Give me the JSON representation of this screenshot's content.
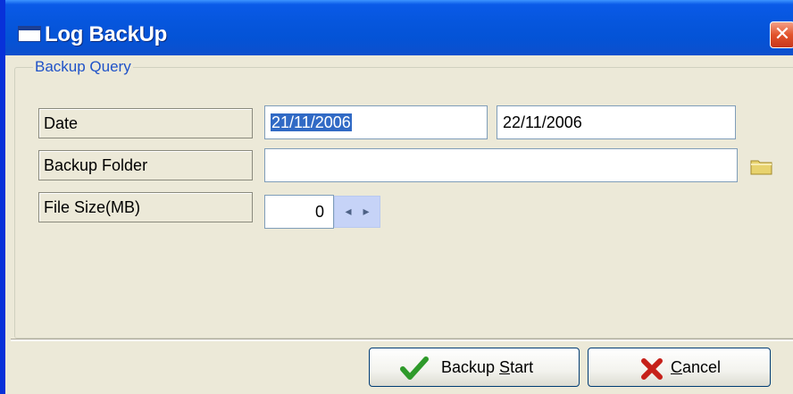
{
  "window": {
    "title": "Log BackUp",
    "close_symbol": "✕"
  },
  "group": {
    "title": "Backup Query"
  },
  "fields": {
    "date": {
      "label": "Date",
      "from": "21/11/2006",
      "to": "22/11/2006"
    },
    "backup_folder": {
      "label": "Backup Folder",
      "value": ""
    },
    "file_size": {
      "label": "File Size(MB)",
      "value": "0",
      "spin_left": "◂",
      "spin_right": "▸"
    }
  },
  "buttons": {
    "backup_start": {
      "label_prefix": "Backup ",
      "label_hotkey": "S",
      "label_suffix": "tart",
      "icon": "check-icon"
    },
    "cancel": {
      "label_prefix": "",
      "label_hotkey": "C",
      "label_suffix": "ancel",
      "icon": "x-icon"
    }
  },
  "colors": {
    "titlebar": "#0656dd",
    "selection": "#316ac5",
    "group_title": "#1f52c8"
  }
}
